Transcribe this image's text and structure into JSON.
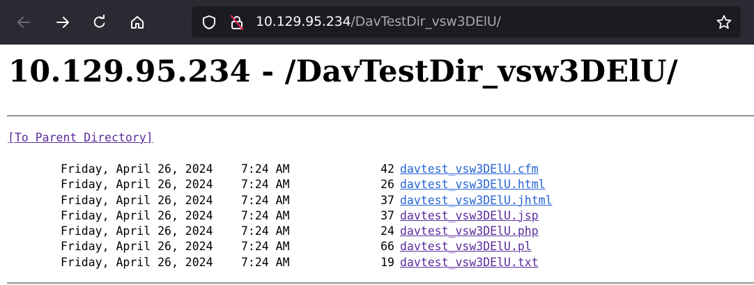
{
  "browser": {
    "url_host": "10.129.95.234",
    "url_path": "/DavTestDir_vsw3DElU/",
    "icons": [
      "back-arrow-icon",
      "forward-arrow-icon",
      "reload-icon",
      "home-icon",
      "shield-icon",
      "insecure-lock-icon",
      "bookmark-star-icon"
    ]
  },
  "page": {
    "heading": "10.129.95.234 - /DavTestDir_vsw3DElU/",
    "parent_link": "[To Parent Directory]",
    "files": [
      {
        "date": "Friday, April 26, 2024",
        "time": "7:24 AM",
        "size": "42",
        "name": "davtest_vsw3DElU.cfm",
        "visited": false
      },
      {
        "date": "Friday, April 26, 2024",
        "time": "7:24 AM",
        "size": "26",
        "name": "davtest_vsw3DElU.html",
        "visited": false
      },
      {
        "date": "Friday, April 26, 2024",
        "time": "7:24 AM",
        "size": "37",
        "name": "davtest_vsw3DElU.jhtml",
        "visited": false
      },
      {
        "date": "Friday, April 26, 2024",
        "time": "7:24 AM",
        "size": "37",
        "name": "davtest_vsw3DElU.jsp",
        "visited": true
      },
      {
        "date": "Friday, April 26, 2024",
        "time": "7:24 AM",
        "size": "24",
        "name": "davtest_vsw3DElU.php",
        "visited": true
      },
      {
        "date": "Friday, April 26, 2024",
        "time": "7:24 AM",
        "size": "66",
        "name": "davtest_vsw3DElU.pl",
        "visited": true
      },
      {
        "date": "Friday, April 26, 2024",
        "time": "7:24 AM",
        "size": "19",
        "name": "davtest_vsw3DElU.txt",
        "visited": true
      }
    ]
  },
  "colors": {
    "toolbar_bg": "#2b2a33",
    "urlbar_bg": "#1c1b22",
    "link_unvisited": "#2563d9",
    "link_visited": "#5a2b9c"
  }
}
